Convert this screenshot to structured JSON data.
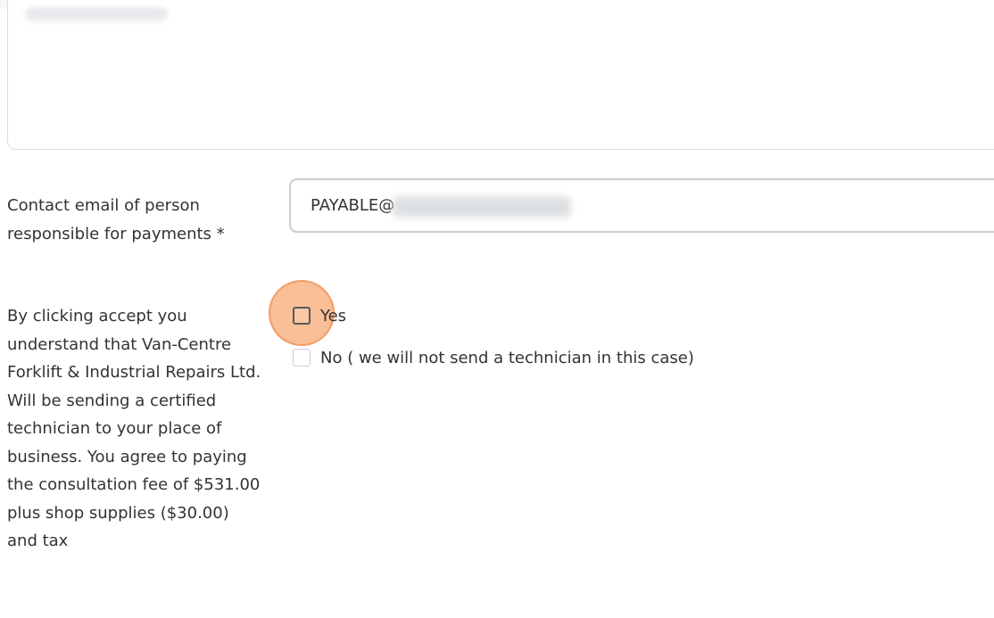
{
  "form": {
    "contact_email": {
      "label": "Contact email of person responsible for payments *",
      "value": "PAYABLE@"
    },
    "accept": {
      "label": "By clicking accept you understand that Van-Centre Forklift & Industrial Repairs Ltd. Will be sending a certified technician to your place of business. You agree to paying the consultation fee of $531.00 plus shop supplies ($30.00) and tax",
      "options": [
        {
          "label": "Yes",
          "checked": false
        },
        {
          "label": "No ( we will not send a technician in this case)",
          "checked": false
        }
      ]
    }
  },
  "colors": {
    "highlight": "#f7aa73",
    "input_border": "#c8ccd0",
    "text": "#333333"
  }
}
